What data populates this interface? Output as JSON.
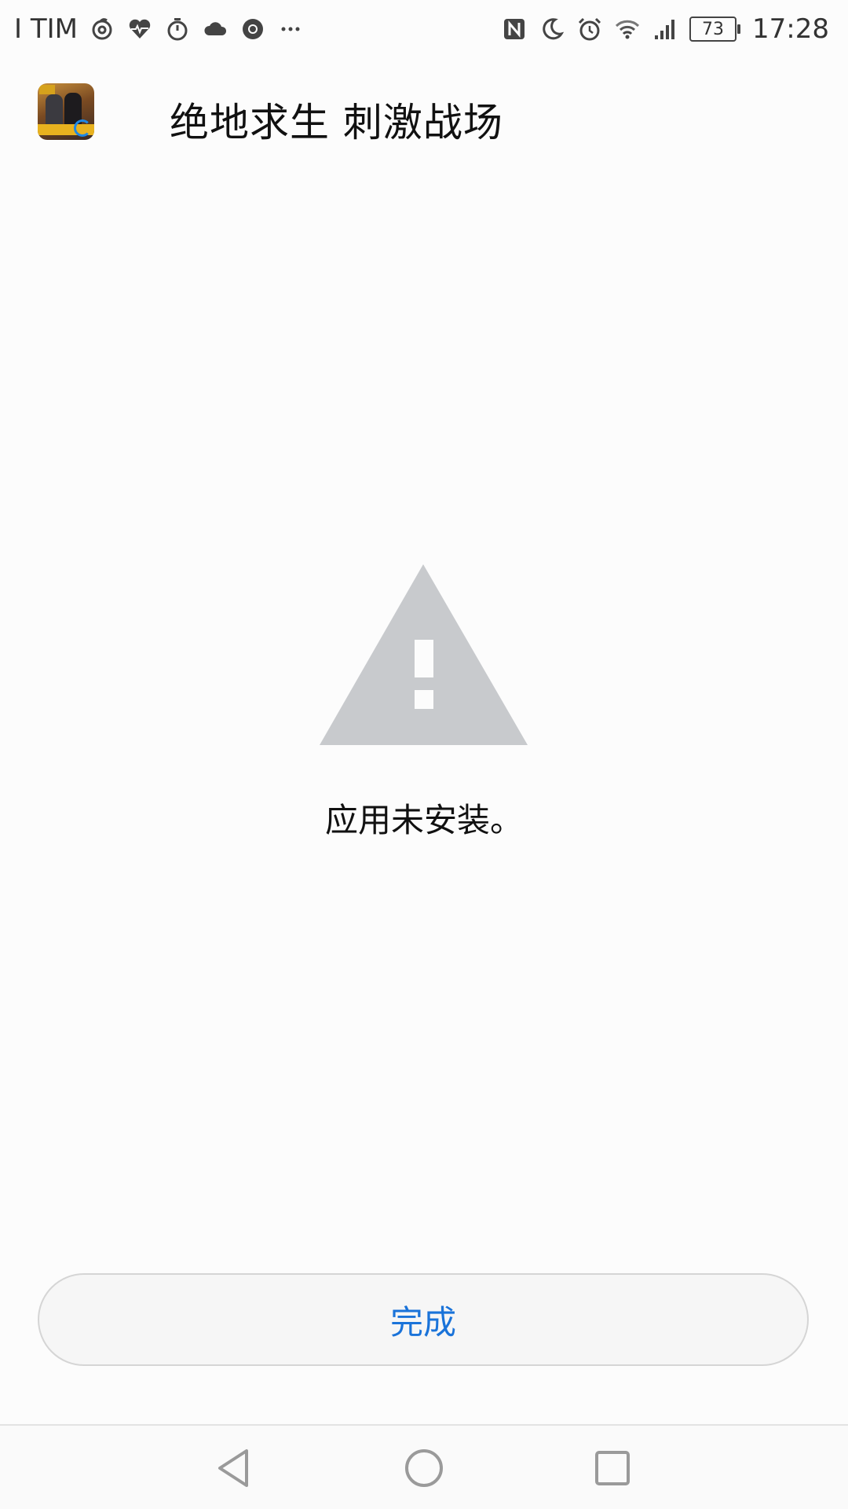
{
  "status_bar": {
    "carrier": "I TIM",
    "battery_level": "73",
    "time": "17:28",
    "icons_left": [
      "netease-music-icon",
      "heart-rate-icon",
      "stopwatch-icon",
      "cloud-icon",
      "chrome-icon",
      "more-dots-icon"
    ],
    "icons_right": [
      "nfc-icon",
      "moon-icon",
      "alarm-icon",
      "wifi-icon",
      "signal-icon",
      "battery-icon"
    ]
  },
  "app": {
    "title": "绝地求生 刺激战场",
    "icon": "pubg-mobile-app-icon"
  },
  "status": {
    "icon": "warning-triangle-icon",
    "message": "应用未安装。"
  },
  "actions": {
    "done_label": "完成"
  },
  "nav": {
    "back": "back-triangle-icon",
    "home": "home-circle-icon",
    "recent": "recent-square-icon"
  },
  "colors": {
    "accent": "#1a73d9",
    "warning_icon": "#c8cacd",
    "background": "#fcfcfc"
  }
}
